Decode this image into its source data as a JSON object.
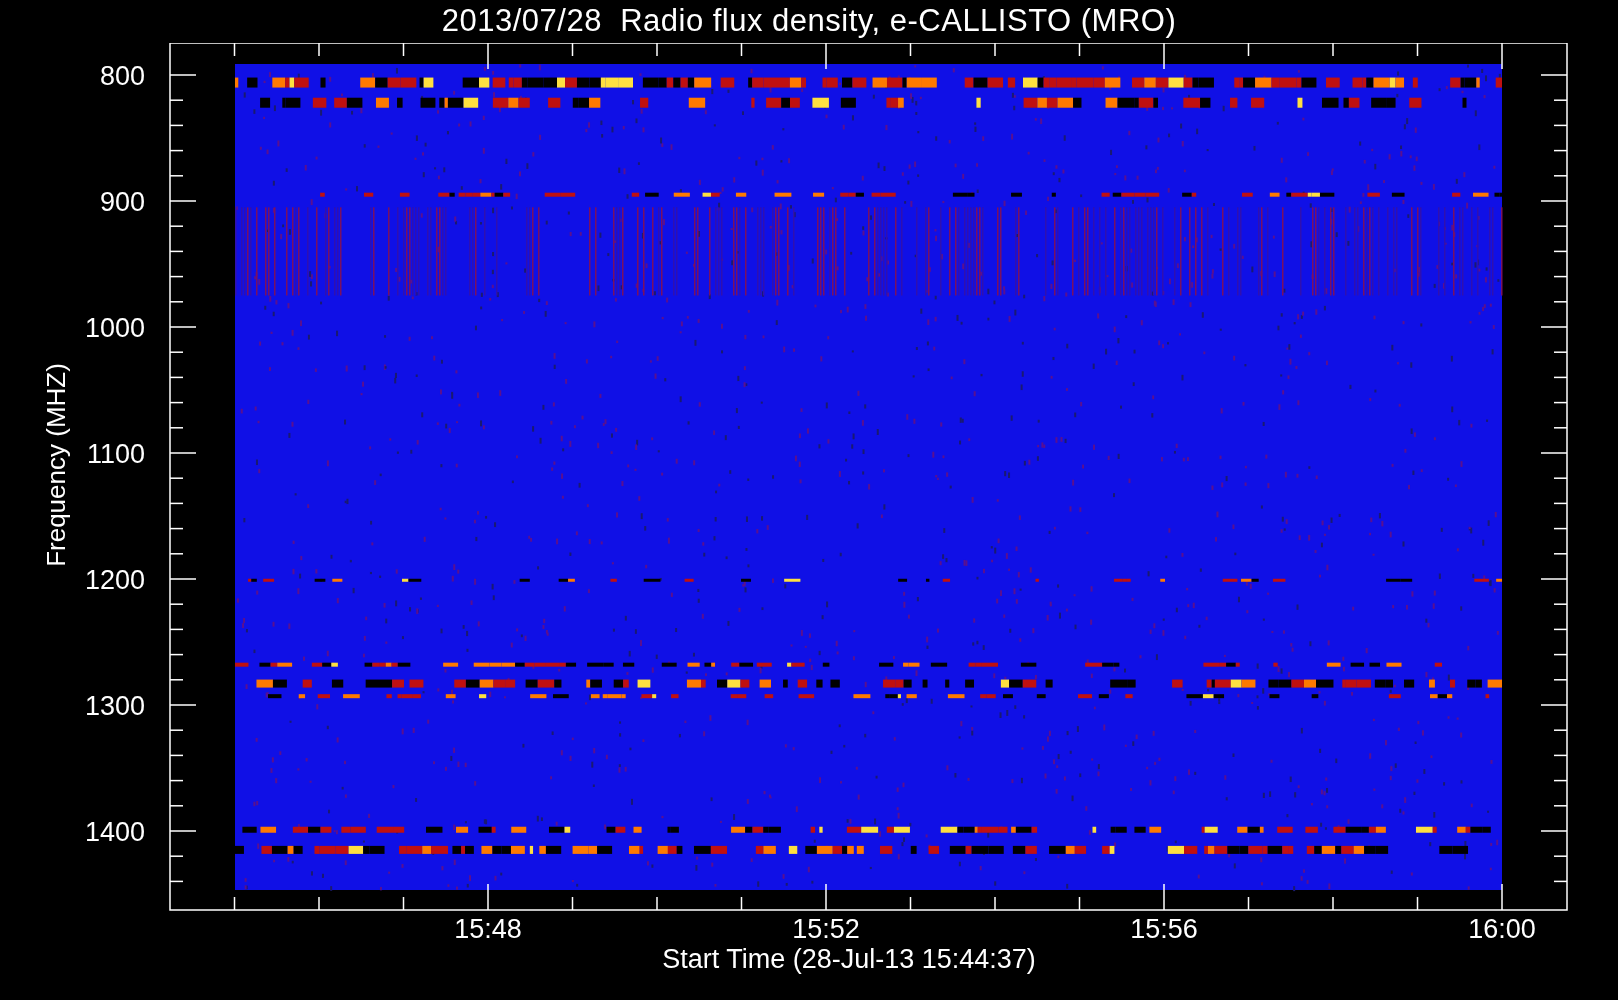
{
  "title": "2013/07/28  Radio flux density, e-CALLISTO (MRO)",
  "y_axis": {
    "label": "Frequency (MHZ)",
    "ticks": [
      "800",
      "900",
      "1000",
      "1100",
      "1200",
      "1300",
      "1400"
    ]
  },
  "x_axis": {
    "label": "Start Time (28-Jul-13 15:44:37)",
    "ticks": [
      "15:48",
      "15:52",
      "15:56",
      "16:00"
    ]
  }
}
